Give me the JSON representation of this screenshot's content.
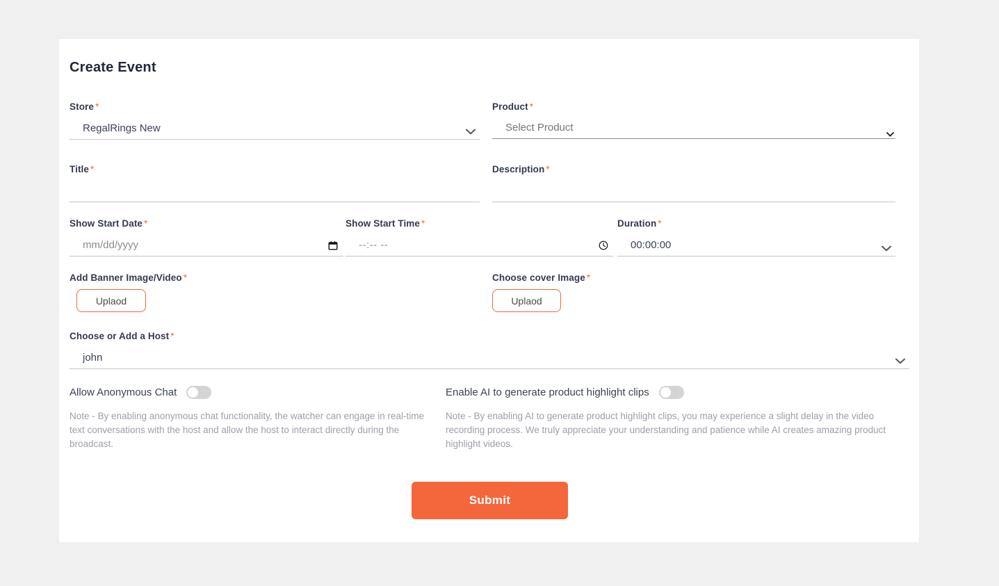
{
  "theme": {
    "page_background": "#f0f0f0",
    "card_background": "#ffffff",
    "accent": "#f4663c",
    "label_color": "#333a4d",
    "note_color": "#9b9fa8",
    "underline_color": "#c6c6c6"
  },
  "header": {
    "title": "Create Event"
  },
  "form": {
    "store": {
      "label": "Store",
      "required_marker": "*",
      "value": "RegalRings New",
      "options": [
        "RegalRings New"
      ],
      "icon": "chevron-down-icon"
    },
    "product": {
      "label": "Product",
      "required_marker": "*",
      "value": "Select Product",
      "options": [
        "Select Product"
      ],
      "icon": "chevron-down-icon"
    },
    "title": {
      "label": "Title",
      "required_marker": "*",
      "value": "",
      "placeholder": ""
    },
    "description": {
      "label": "Description",
      "required_marker": "*",
      "value": "",
      "placeholder": ""
    },
    "show_start_date": {
      "label": "Show Start Date",
      "required_marker": "*",
      "value": "",
      "placeholder": "mm/dd/yyyy",
      "icon": "calendar-icon"
    },
    "show_start_time": {
      "label": "Show Start Time",
      "required_marker": "*",
      "value": "",
      "placeholder": "--:-- --",
      "icon": "clock-icon"
    },
    "duration": {
      "label": "Duration",
      "required_marker": "*",
      "value": "00:00:00",
      "options": [
        "00:00:00"
      ],
      "icon": "chevron-down-icon"
    },
    "banner_upload": {
      "label": "Add Banner Image/Video",
      "required_marker": "*",
      "button_label": "Uplaod"
    },
    "cover_upload": {
      "label": "Choose cover Image",
      "required_marker": "*",
      "button_label": "Uplaod"
    },
    "host": {
      "label": "Choose or Add a Host",
      "required_marker": "*",
      "value": "john",
      "options": [
        "john"
      ],
      "icon": "chevron-down-icon"
    },
    "anonymous_chat": {
      "label": "Allow Anonymous Chat",
      "state": "off",
      "note": "Note - By enabling anonymous chat functionality, the watcher can engage in real-time text conversations with the host and allow the host to interact directly during the broadcast."
    },
    "ai_highlights": {
      "label": "Enable AI to generate product highlight clips",
      "state": "off",
      "note": "Note - By enabling AI to generate product highlight clips, you may experience a slight delay in the video recording process. We truly appreciate your understanding and patience while AI creates amazing product highlight videos."
    },
    "submit": {
      "label": "Submit"
    }
  }
}
